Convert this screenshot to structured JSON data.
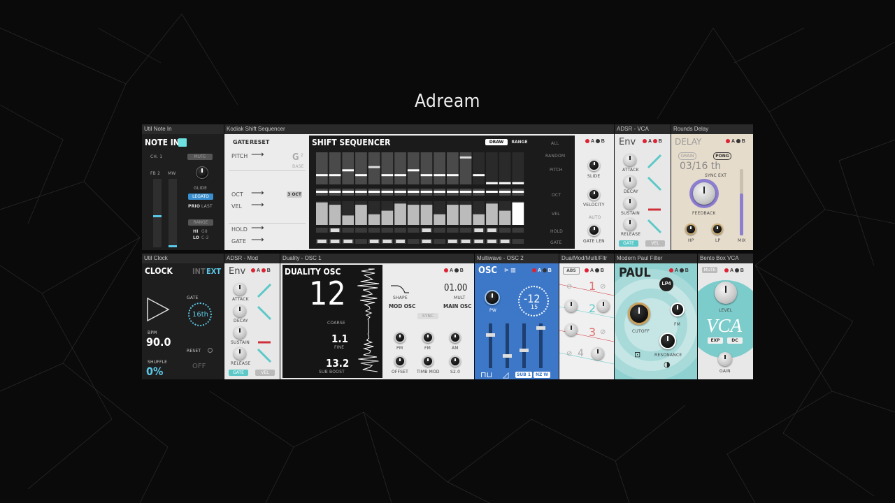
{
  "window_title": "Adream",
  "colors": {
    "teal": "#5dc8c8",
    "red": "#d0303a",
    "blue": "#3d78c8",
    "background": "#0a0a0a"
  },
  "note_in": {
    "header": "Util Note In",
    "title": "NOTE IN",
    "ch": "CH. 1",
    "mute": "MUTE",
    "fb": "FB 2",
    "mw": "MW",
    "glide": "GLIDE",
    "legato": "LEGATO",
    "prio": "PRIO",
    "prio_val": "LAST",
    "range": "RANGE",
    "hi": "HI",
    "hi_val": "G8",
    "lo": "LO",
    "lo_val": "C-2"
  },
  "shift_seq": {
    "header": "Kodiak Shift Sequencer",
    "gate": "GATE",
    "reset": "RESET",
    "pitch": "PITCH",
    "base_note": "G",
    "base_oct": "2",
    "base": "BASE",
    "oct": "OCT",
    "oct_val": "3 OCT",
    "vel": "VEL",
    "hold": "HOLD",
    "gate_row": "GATE",
    "title": "SHIFT SEQUENCER",
    "draw": "DRAW",
    "range": "RANGE",
    "side": {
      "all": "ALL",
      "random": "RANDOM",
      "pitch": "PITCH",
      "oct": "OCT",
      "vel": "VEL",
      "hold": "HOLD",
      "gate": "GATE"
    },
    "slide": "SLIDE",
    "velocity": "VELOCITY",
    "auto": "AUTO",
    "gate_len": "GATE LEN",
    "a": "A",
    "b": "B",
    "pitch_steps": [
      0.3,
      0.3,
      0.45,
      0.3,
      0.55,
      0.3,
      0.3,
      0.45,
      0.3,
      0.3,
      0.3,
      0.85,
      0.3,
      0.05,
      0.05,
      0.05
    ],
    "vel_steps": [
      0.95,
      0.85,
      0.4,
      0.85,
      0.45,
      0.6,
      0.9,
      0.85,
      0.85,
      0.45,
      0.85,
      0.85,
      0.45,
      0.9,
      0.6,
      0.95
    ]
  },
  "adsr1": {
    "header": "ADSR - VCA",
    "title": "Env",
    "a": "A",
    "b": "B",
    "attack": "ATTACK",
    "decay": "DECAY",
    "sustain": "SUSTAIN",
    "release": "RELEASE",
    "gate": "GATE",
    "vel": "VEL"
  },
  "delay": {
    "header": "Rounds Delay",
    "title": "DELAY",
    "a": "A",
    "b": "B",
    "grain": "GRAIN",
    "pong": "PONG",
    "time": "03/16 th",
    "sync": "SYNC EXT",
    "feedback": "FEEDBACK",
    "hp": "HP",
    "lp": "LP",
    "mix": "MIX"
  },
  "clock": {
    "header": "Util Clock",
    "title": "CLOCK",
    "int": "INT",
    "ext": "EXT",
    "gate": "GATE",
    "gate_val": "16th",
    "bpm": "BPM",
    "bpm_val": "90.0",
    "reset": "RESET",
    "shuffle": "SHUFFLE",
    "shuffle_val": "0%",
    "off": "OFF"
  },
  "adsr2": {
    "header": "ADSR - Mod",
    "title": "Env",
    "a": "A",
    "b": "B",
    "attack": "ATTACK",
    "decay": "DECAY",
    "sustain": "SUSTAIN",
    "release": "RELEASE",
    "gate": "GATE",
    "vel": "VEL"
  },
  "duality": {
    "header": "Duality - OSC 1",
    "title": "DUALITY OSC",
    "coarse_val": "12",
    "coarse": "COARSE",
    "fine_val": "1.1",
    "fine": "FINE",
    "subboost_val": "13.2",
    "subboost": "SUB BOOST",
    "a": "A",
    "b": "B",
    "shape": "SHAPE",
    "mult_val": "01.00",
    "mult": "MULT",
    "mod_osc": "MOD OSC",
    "main_osc": "MAIN OSC",
    "sync": "SYNC",
    "pm": "PM",
    "fm": "FM",
    "am": "AM",
    "offset": "OFFSET",
    "timb_mod": "TIMB MOD",
    "s2": "S2.0"
  },
  "multiwave": {
    "header": "Multiwave - OSC 2",
    "title": "OSC",
    "a": "A",
    "b": "B",
    "pw": "PW",
    "tune": "-12",
    "tune_sub": "15",
    "sub1": "SUB 1",
    "nzw": "NZ W"
  },
  "dua_mod": {
    "header": "Dua/Mod/Multi/Fltr",
    "abs": "ABS",
    "a": "A",
    "b": "B",
    "n1": "1",
    "n2": "2",
    "n3": "3",
    "n4": "4"
  },
  "paul": {
    "header": "Modern Paul Filter",
    "title": "PAUL",
    "a": "A",
    "b": "B",
    "lp4": "LP4",
    "cutoff": "CUTOFF",
    "fm": "FM",
    "resonance": "RESONANCE"
  },
  "vca": {
    "header": "Bento Box VCA",
    "mute": "MUTE",
    "a": "A",
    "b": "B",
    "level": "LEVEL",
    "title": "VCA",
    "exp": "EXP",
    "dc": "DC",
    "gain": "GAIN"
  }
}
